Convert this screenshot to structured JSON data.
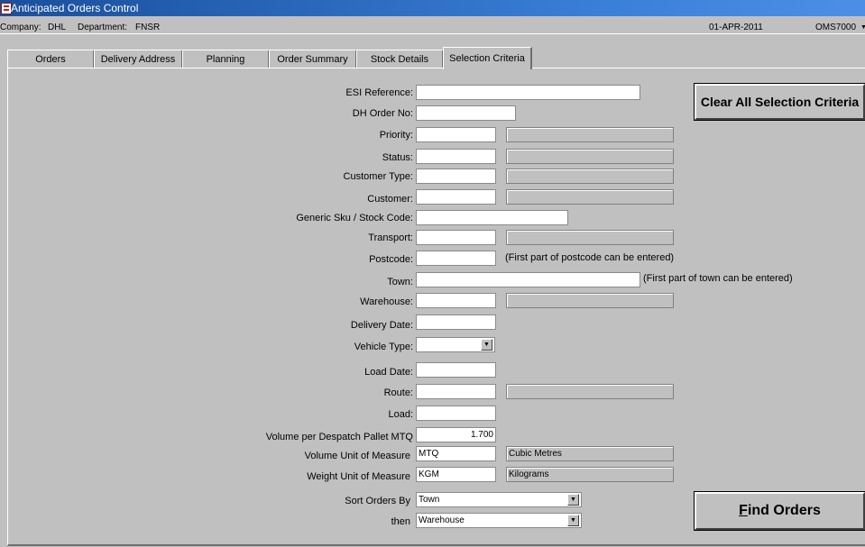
{
  "window": {
    "title": "Anticipated Orders Control"
  },
  "header": {
    "company_label": "Company:",
    "company": "DHL",
    "department_label": "Department:",
    "department": "FNSR",
    "date": "01-APR-2011",
    "program": "OMS7000"
  },
  "tabs": [
    {
      "label": "Orders"
    },
    {
      "label": "Delivery Address"
    },
    {
      "label": "Planning"
    },
    {
      "label": "Order Summary"
    },
    {
      "label": "Stock Details"
    },
    {
      "label": "Selection Criteria",
      "active": true
    }
  ],
  "criteria": {
    "esi_reference": {
      "label": "ESI Reference:",
      "value": ""
    },
    "dh_order_no": {
      "label": "DH Order No:",
      "value": ""
    },
    "priority": {
      "label": "Priority:",
      "value": "",
      "description": ""
    },
    "status": {
      "label": "Status:",
      "value": "",
      "description": ""
    },
    "customer_type": {
      "label": "Customer Type:",
      "value": "",
      "description": ""
    },
    "customer": {
      "label": "Customer:",
      "value": "",
      "description": ""
    },
    "generic_sku": {
      "label": "Generic Sku / Stock Code:",
      "value": ""
    },
    "transport": {
      "label": "Transport:",
      "value": "",
      "description": ""
    },
    "postcode": {
      "label": "Postcode:",
      "value": "",
      "hint": "(First part of postcode can be entered)"
    },
    "town": {
      "label": "Town:",
      "value": "",
      "hint": "(First part of town can be entered)"
    },
    "warehouse": {
      "label": "Warehouse:",
      "value": "",
      "description": ""
    },
    "delivery_date": {
      "label": "Delivery Date:",
      "value": ""
    },
    "vehicle_type": {
      "label": "Vehicle Type:",
      "value": ""
    },
    "load_date": {
      "label": "Load Date:",
      "value": ""
    },
    "route": {
      "label": "Route:",
      "value": "",
      "description": ""
    },
    "load": {
      "label": "Load:",
      "value": ""
    },
    "volume_per_pallet": {
      "label": "Volume per Despatch Pallet MTQ",
      "value": "1.700"
    },
    "volume_uom": {
      "label": "Volume Unit of Measure",
      "value": "MTQ",
      "description": "Cubic Metres"
    },
    "weight_uom": {
      "label": "Weight Unit of Measure",
      "value": "KGM",
      "description": "Kilograms"
    },
    "sort_orders_by": {
      "label": "Sort Orders By",
      "value": "Town"
    },
    "then_by": {
      "label": "then",
      "value": "Warehouse"
    }
  },
  "buttons": {
    "clear_all": "Clear All Selection Criteria",
    "find_orders": "Find Orders"
  }
}
